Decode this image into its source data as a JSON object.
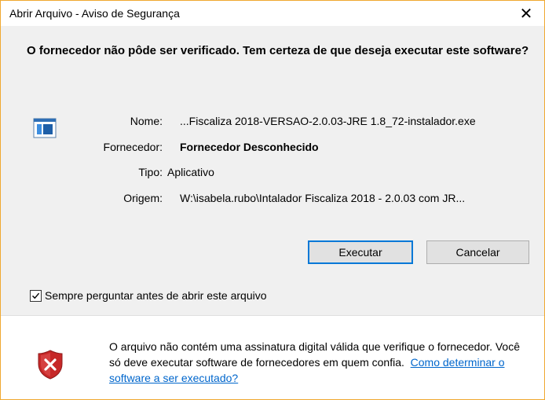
{
  "window": {
    "title": "Abrir Arquivo - Aviso de Segurança",
    "close_glyph": "✕"
  },
  "question": "O fornecedor não pôde ser verificado. Tem certeza de que deseja executar este software?",
  "icons": {
    "app": "application-icon",
    "shield": "shield-error-icon"
  },
  "details": {
    "name_label": "Nome:",
    "name_value": "...Fiscaliza 2018-VERSAO-2.0.03-JRE 1.8_72-instalador.exe",
    "publisher_label": "Fornecedor:",
    "publisher_value": "Fornecedor Desconhecido",
    "type_label": "Tipo:",
    "type_value": "Aplicativo",
    "origin_label": "Origem:",
    "origin_value": "W:\\isabela.rubo\\Intalador Fiscaliza 2018 - 2.0.03 com JR..."
  },
  "buttons": {
    "run": "Executar",
    "cancel": "Cancelar"
  },
  "checkbox": {
    "label": "Sempre perguntar antes de abrir este arquivo",
    "checked": true
  },
  "warning": {
    "text": "O arquivo não contém uma assinatura digital válida que verifique o fornecedor. Você só deve executar software de fornecedores em quem confia.",
    "link": "Como determinar o software a ser executado?"
  },
  "colors": {
    "accent": "#0078d7",
    "border": "#f0a830",
    "link": "#0066cc",
    "shield_red": "#c62828"
  }
}
